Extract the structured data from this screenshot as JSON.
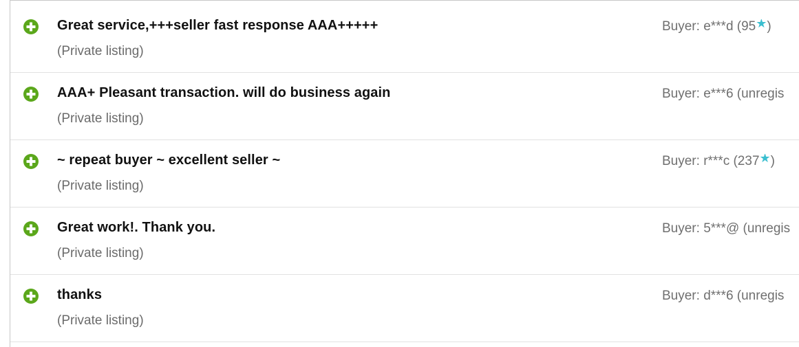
{
  "colors": {
    "positive_icon": "#5ba71b",
    "star": "#3bbfd0",
    "comment_text": "#111111",
    "meta_text": "#6b6b6b"
  },
  "feedback": [
    {
      "icon": "plus-circle-icon",
      "comment": "Great service,+++seller fast response AAA+++++",
      "listing": "(Private listing)",
      "buyer_prefix": "Buyer: e***d (95",
      "buyer_star": "★",
      "buyer_suffix": ")"
    },
    {
      "icon": "plus-circle-icon",
      "comment": "AAA+ Pleasant transaction. will do business again",
      "listing": "(Private listing)",
      "buyer_prefix": "Buyer: e***6 (unregis",
      "buyer_star": "",
      "buyer_suffix": ""
    },
    {
      "icon": "plus-circle-icon",
      "comment": "~ repeat buyer ~ excellent seller ~",
      "listing": "(Private listing)",
      "buyer_prefix": "Buyer: r***c (237",
      "buyer_star": "★",
      "buyer_suffix": ")"
    },
    {
      "icon": "plus-circle-icon",
      "comment": "Great work!. Thank you.",
      "listing": "(Private listing)",
      "buyer_prefix": "Buyer: 5***@ (unregis",
      "buyer_star": "",
      "buyer_suffix": ""
    },
    {
      "icon": "plus-circle-icon",
      "comment": "thanks",
      "listing": "(Private listing)",
      "buyer_prefix": "Buyer: d***6 (unregis",
      "buyer_star": "",
      "buyer_suffix": ""
    }
  ]
}
